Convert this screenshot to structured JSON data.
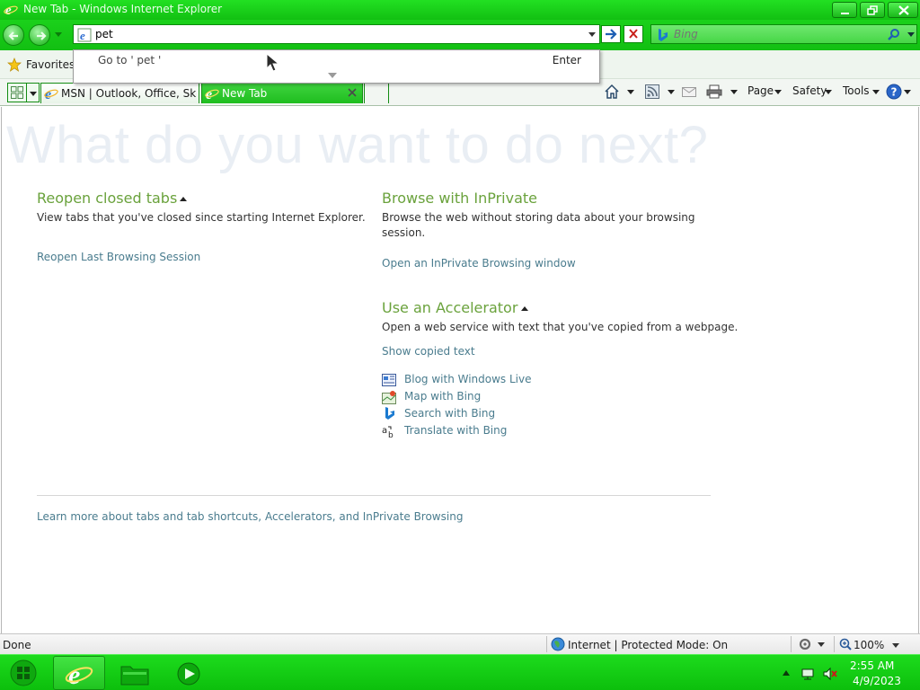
{
  "window": {
    "title": "New Tab - Windows Internet Explorer"
  },
  "address_bar": {
    "value": "pet",
    "go_label": "Go to ' pet '",
    "enter_label": "Enter"
  },
  "search": {
    "placeholder": "Bing"
  },
  "favorites": {
    "label": "Favorites"
  },
  "tabs": [
    {
      "label": "MSN | Outlook, Office, Sky...",
      "active": false
    },
    {
      "label": "New Tab",
      "active": true
    }
  ],
  "toolbar": {
    "page_label": "Page",
    "safety_label": "Safety",
    "tools_label": "Tools"
  },
  "content": {
    "hero": "What do you want to do next?",
    "reopen": {
      "title": "Reopen closed tabs",
      "description": "View tabs that you've closed since starting Internet Explorer.",
      "link": "Reopen Last Browsing Session"
    },
    "inprivate": {
      "title": "Browse with InPrivate",
      "description": "Browse the web without storing data about your browsing session.",
      "link": "Open an InPrivate Browsing window"
    },
    "accelerator": {
      "title": "Use an Accelerator",
      "description": "Open a web service with text that you've copied from a webpage.",
      "show_link": "Show copied text",
      "items": [
        "Blog with Windows Live",
        "Map with Bing",
        "Search with Bing",
        "Translate with Bing"
      ]
    },
    "footer_link": "Learn more about tabs and tab shortcuts, Accelerators, and InPrivate Browsing"
  },
  "statusbar": {
    "status": "Done",
    "zone": "Internet | Protected Mode: On",
    "zoom": "100%"
  },
  "taskbar": {
    "time": "2:55 AM",
    "date": "4/9/2023"
  },
  "colors": {
    "chrome_green": "#1ad11a",
    "heading_green": "#6aa23c",
    "link_blue": "#4a7c8e"
  }
}
